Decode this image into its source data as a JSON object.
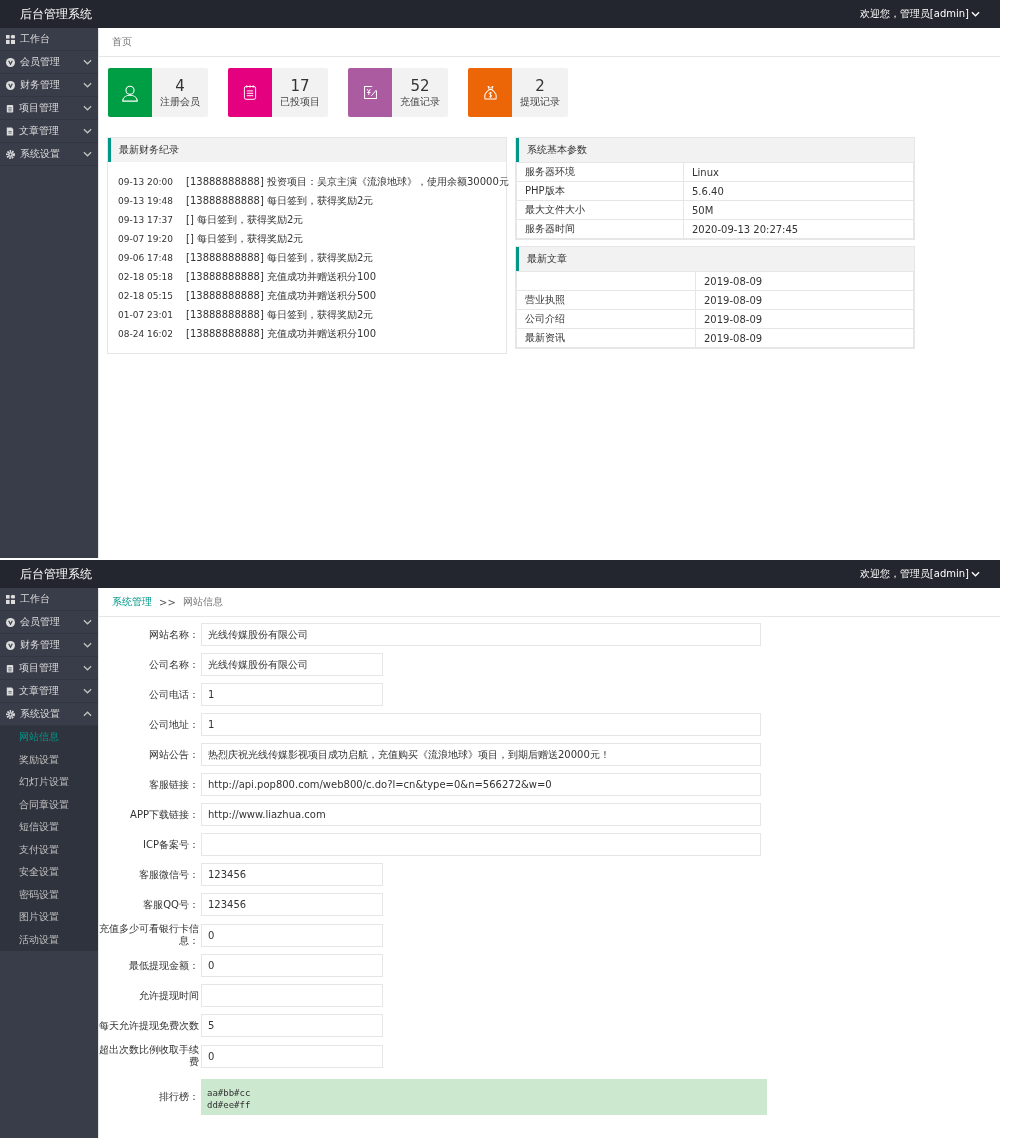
{
  "frames": [
    {
      "kind": "dashboard",
      "header": {
        "title": "后台管理系统",
        "user": "欢迎您，管理员[admin]"
      },
      "sidebar": [
        {
          "label": "工作台",
          "kind": "link"
        },
        {
          "label": "会员管理",
          "kind": "menu",
          "expanded": false
        },
        {
          "label": "财务管理",
          "kind": "menu",
          "expanded": false
        },
        {
          "label": "项目管理",
          "kind": "menu",
          "expanded": false
        },
        {
          "label": "文章管理",
          "kind": "menu",
          "expanded": false
        },
        {
          "label": "系统设置",
          "kind": "menu",
          "expanded": false
        }
      ],
      "breadcrumb": [
        {
          "label": "首页",
          "kind": "current"
        }
      ],
      "stats": [
        {
          "value": "4",
          "label": "注册会员",
          "color": "#009e44"
        },
        {
          "value": "17",
          "label": "已投项目",
          "color": "#e5007f"
        },
        {
          "value": "52",
          "label": "充值记录",
          "color": "#ab5ca0"
        },
        {
          "value": "2",
          "label": "提现记录",
          "color": "#ec6608"
        }
      ],
      "finance": {
        "title": "最新财务纪录",
        "records": [
          {
            "time": "09-13 20:00",
            "text": "[13888888888] 投资项目：吴京主演《流浪地球》，使用余额30000元"
          },
          {
            "time": "09-13 19:48",
            "text": "[13888888888] 每日签到，获得奖励2元"
          },
          {
            "time": "09-13 17:37",
            "text": "[] 每日签到，获得奖励2元"
          },
          {
            "time": "09-07 19:20",
            "text": "[] 每日签到，获得奖励2元"
          },
          {
            "time": "09-06 17:48",
            "text": "[13888888888] 每日签到，获得奖励2元"
          },
          {
            "time": "02-18 05:18",
            "text": "[13888888888] 充值成功并赠送积分100"
          },
          {
            "time": "02-18 05:15",
            "text": "[13888888888] 充值成功并赠送积分500"
          },
          {
            "time": "01-07 23:01",
            "text": "[13888888888] 每日签到，获得奖励2元"
          },
          {
            "time": "08-24 16:02",
            "text": "[13888888888] 充值成功并赠送积分100"
          }
        ]
      },
      "params": {
        "title": "系统基本参数",
        "rows": [
          {
            "name": "服务器环境",
            "value": "Linux"
          },
          {
            "name": "PHP版本",
            "value": "5.6.40"
          },
          {
            "name": "最大文件大小",
            "value": "50M"
          },
          {
            "name": "服务器时间",
            "value": "2020-09-13 20:27:45"
          }
        ]
      },
      "articles": {
        "title": "最新文章",
        "rows": [
          {
            "date": "2019-08-09"
          },
          {
            "name": "营业执照",
            "date": "2019-08-09"
          },
          {
            "name": "公司介绍",
            "date": "2019-08-09"
          },
          {
            "name": "最新资讯",
            "date": "2019-08-09"
          }
        ]
      }
    },
    {
      "kind": "settings",
      "header": {
        "title": "后台管理系统",
        "user": "欢迎您，管理员[admin]"
      },
      "sidebar": [
        {
          "label": "工作台",
          "kind": "link"
        },
        {
          "label": "会员管理",
          "kind": "menu",
          "expanded": false
        },
        {
          "label": "财务管理",
          "kind": "menu",
          "expanded": false
        },
        {
          "label": "项目管理",
          "kind": "menu",
          "expanded": false
        },
        {
          "label": "文章管理",
          "kind": "menu",
          "expanded": false
        },
        {
          "label": "系统设置",
          "kind": "menu",
          "expanded": true,
          "children": [
            {
              "label": "网站信息",
              "selected": true
            },
            {
              "label": "奖励设置",
              "selected": false
            },
            {
              "label": "幻灯片设置",
              "selected": false
            },
            {
              "label": "合同章设置",
              "selected": false
            },
            {
              "label": "短信设置",
              "selected": false
            },
            {
              "label": "支付设置",
              "selected": false
            },
            {
              "label": "安全设置",
              "selected": false
            },
            {
              "label": "密码设置",
              "selected": false
            },
            {
              "label": "图片设置",
              "selected": false
            },
            {
              "label": "活动设置",
              "selected": false
            }
          ]
        }
      ],
      "breadcrumb": [
        {
          "label": "系统管理",
          "kind": "link"
        },
        {
          "label": ">>",
          "kind": "separator"
        },
        {
          "label": "网站信息",
          "kind": "current"
        }
      ],
      "form": [
        {
          "label": "网站名称：",
          "value": "光线传媒股份有限公司",
          "kind": "long"
        },
        {
          "label": "公司名称：",
          "value": "光线传媒股份有限公司",
          "kind": "short"
        },
        {
          "label": "公司电话：",
          "value": "1",
          "kind": "short"
        },
        {
          "label": "公司地址：",
          "value": "1",
          "kind": "long"
        },
        {
          "label": "网站公告：",
          "value": "热烈庆祝光线传媒影视项目成功启航，充值购买《流浪地球》项目，到期后赠送20000元！",
          "kind": "long"
        },
        {
          "label": "客服链接：",
          "value": "http://api.pop800.com/web800/c.do?l=cn&type=0&n=566272&w=0",
          "kind": "long"
        },
        {
          "label": "APP下载链接：",
          "value": "http://www.liazhua.com",
          "kind": "long"
        },
        {
          "label": "ICP备案号：",
          "kind": "long"
        },
        {
          "label": "客服微信号：",
          "value": "123456",
          "kind": "short"
        },
        {
          "label": "客服QQ号：",
          "value": "123456",
          "kind": "short"
        },
        {
          "label": "充值多少可看银行卡信息：",
          "value": "0",
          "kind": "short"
        },
        {
          "label": "最低提现金额：",
          "value": "0",
          "kind": "short"
        },
        {
          "label": "允许提现时间",
          "kind": "short"
        },
        {
          "label": "每天允许提现免费次数",
          "value": "5",
          "kind": "short"
        },
        {
          "label": "超出次数比例收取手续费",
          "value": "0",
          "kind": "short"
        },
        {
          "label": "排行榜：",
          "value": "aa#bb#cc\ndd#ee#ff",
          "kind": "textarea"
        }
      ]
    }
  ]
}
